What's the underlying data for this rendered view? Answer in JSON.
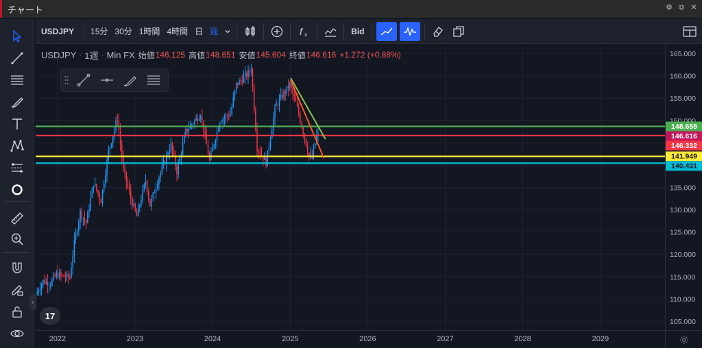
{
  "window": {
    "title": "チャート"
  },
  "toolbar": {
    "symbol": "USDJPY",
    "intervals": [
      "15分",
      "30分",
      "1時間",
      "4時間",
      "日",
      "週"
    ],
    "active_interval": "週",
    "price_type": "Bid"
  },
  "legend": {
    "symbol": "USDJPY",
    "interval": "1週",
    "source": "Min FX",
    "open_label": "始値",
    "open": "146.125",
    "high_label": "高値",
    "high": "148.651",
    "low_label": "安値",
    "low": "145.604",
    "close_label": "終値",
    "close": "146.616",
    "change": "+1.272 (+0.88%)"
  },
  "logo": {
    "text": "17"
  },
  "colors": {
    "background": "#131722",
    "up": "#26a69a",
    "down": "#ef5350",
    "candle_up": "#2196f3",
    "candle_down": "#f23645",
    "level_green": "#4caf50",
    "level_red": "#f23645",
    "level_yellow": "#ffeb3b",
    "level_cyan": "#00bcd4",
    "trend_green": "#8bc34a",
    "trend_orange": "#ff5722"
  },
  "chart_data": {
    "type": "candlestick",
    "x_ticks": [
      "2022",
      "2023",
      "2024",
      "2025",
      "2026",
      "2027",
      "2028",
      "2029"
    ],
    "xlim": [
      "2021-09-20",
      "2029-11-01"
    ],
    "ylim": [
      103,
      167
    ],
    "y_ticks": [
      "105.000",
      "110.000",
      "115.000",
      "120.000",
      "125.000",
      "130.000",
      "135.000",
      "140.000",
      "145.000",
      "150.000",
      "155.000",
      "160.000",
      "165.000"
    ],
    "price_path": [
      [
        "2021-09-27",
        111.0
      ],
      [
        "2021-11-01",
        114.0
      ],
      [
        "2021-12-06",
        113.5
      ],
      [
        "2022-01-03",
        115.5
      ],
      [
        "2022-02-07",
        115.0
      ],
      [
        "2022-03-07",
        114.8
      ],
      [
        "2022-03-28",
        122.5
      ],
      [
        "2022-04-25",
        129.5
      ],
      [
        "2022-05-23",
        127.0
      ],
      [
        "2022-06-27",
        136.0
      ],
      [
        "2022-08-01",
        132.0
      ],
      [
        "2022-09-05",
        143.0
      ],
      [
        "2022-10-17",
        150.5
      ],
      [
        "2022-11-14",
        139.0
      ],
      [
        "2022-12-19",
        132.5
      ],
      [
        "2023-01-16",
        128.5
      ],
      [
        "2023-02-27",
        136.5
      ],
      [
        "2023-03-20",
        131.0
      ],
      [
        "2023-05-01",
        137.5
      ],
      [
        "2023-06-26",
        144.5
      ],
      [
        "2023-07-24",
        138.5
      ],
      [
        "2023-09-04",
        147.5
      ],
      [
        "2023-11-13",
        151.5
      ],
      [
        "2023-12-25",
        141.0
      ],
      [
        "2024-02-12",
        150.0
      ],
      [
        "2024-04-01",
        151.5
      ],
      [
        "2024-04-29",
        158.0
      ],
      [
        "2024-06-24",
        160.5
      ],
      [
        "2024-07-08",
        161.8
      ],
      [
        "2024-08-05",
        144.0
      ],
      [
        "2024-09-16",
        140.5
      ],
      [
        "2024-10-28",
        152.5
      ],
      [
        "2024-11-18",
        154.5
      ],
      [
        "2025-01-06",
        158.0
      ],
      [
        "2025-02-03",
        154.0
      ],
      [
        "2025-03-10",
        147.5
      ],
      [
        "2025-04-07",
        142.0
      ],
      [
        "2025-04-21",
        141.5
      ],
      [
        "2025-05-12",
        146.6
      ]
    ],
    "horizontal_levels": [
      {
        "price": 148.658,
        "label": "148.658",
        "color": "#4caf50"
      },
      {
        "price": 146.616,
        "label": "146.616",
        "color": "#f23645"
      },
      {
        "price": 146.332,
        "label": "146.332",
        "color": "#ef5350"
      },
      {
        "price": 141.949,
        "label": "141.949",
        "color": "#ffeb3b"
      },
      {
        "price": 140.431,
        "label": "140.431",
        "color": "#00bcd4"
      }
    ],
    "trend_lines": [
      {
        "from": [
          "2025-01-03",
          159.5
        ],
        "to": [
          "2025-06-16",
          145.8
        ],
        "color": "#8bc34a"
      },
      {
        "from": [
          "2025-01-03",
          159.0
        ],
        "to": [
          "2025-06-09",
          141.5
        ],
        "color": "#ff5722"
      }
    ]
  }
}
